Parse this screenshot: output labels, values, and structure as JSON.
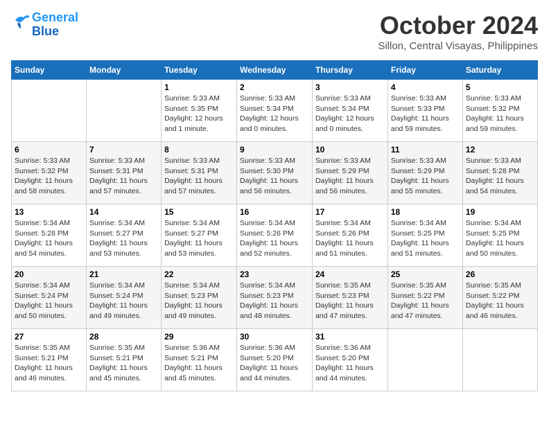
{
  "header": {
    "logo_line1": "General",
    "logo_line2": "Blue",
    "month": "October 2024",
    "location": "Sillon, Central Visayas, Philippines"
  },
  "days_of_week": [
    "Sunday",
    "Monday",
    "Tuesday",
    "Wednesday",
    "Thursday",
    "Friday",
    "Saturday"
  ],
  "weeks": [
    [
      {
        "num": "",
        "info": ""
      },
      {
        "num": "",
        "info": ""
      },
      {
        "num": "1",
        "info": "Sunrise: 5:33 AM\nSunset: 5:35 PM\nDaylight: 12 hours\nand 1 minute."
      },
      {
        "num": "2",
        "info": "Sunrise: 5:33 AM\nSunset: 5:34 PM\nDaylight: 12 hours\nand 0 minutes."
      },
      {
        "num": "3",
        "info": "Sunrise: 5:33 AM\nSunset: 5:34 PM\nDaylight: 12 hours\nand 0 minutes."
      },
      {
        "num": "4",
        "info": "Sunrise: 5:33 AM\nSunset: 5:33 PM\nDaylight: 11 hours\nand 59 minutes."
      },
      {
        "num": "5",
        "info": "Sunrise: 5:33 AM\nSunset: 5:32 PM\nDaylight: 11 hours\nand 59 minutes."
      }
    ],
    [
      {
        "num": "6",
        "info": "Sunrise: 5:33 AM\nSunset: 5:32 PM\nDaylight: 11 hours\nand 58 minutes."
      },
      {
        "num": "7",
        "info": "Sunrise: 5:33 AM\nSunset: 5:31 PM\nDaylight: 11 hours\nand 57 minutes."
      },
      {
        "num": "8",
        "info": "Sunrise: 5:33 AM\nSunset: 5:31 PM\nDaylight: 11 hours\nand 57 minutes."
      },
      {
        "num": "9",
        "info": "Sunrise: 5:33 AM\nSunset: 5:30 PM\nDaylight: 11 hours\nand 56 minutes."
      },
      {
        "num": "10",
        "info": "Sunrise: 5:33 AM\nSunset: 5:29 PM\nDaylight: 11 hours\nand 56 minutes."
      },
      {
        "num": "11",
        "info": "Sunrise: 5:33 AM\nSunset: 5:29 PM\nDaylight: 11 hours\nand 55 minutes."
      },
      {
        "num": "12",
        "info": "Sunrise: 5:33 AM\nSunset: 5:28 PM\nDaylight: 11 hours\nand 54 minutes."
      }
    ],
    [
      {
        "num": "13",
        "info": "Sunrise: 5:34 AM\nSunset: 5:28 PM\nDaylight: 11 hours\nand 54 minutes."
      },
      {
        "num": "14",
        "info": "Sunrise: 5:34 AM\nSunset: 5:27 PM\nDaylight: 11 hours\nand 53 minutes."
      },
      {
        "num": "15",
        "info": "Sunrise: 5:34 AM\nSunset: 5:27 PM\nDaylight: 11 hours\nand 53 minutes."
      },
      {
        "num": "16",
        "info": "Sunrise: 5:34 AM\nSunset: 5:26 PM\nDaylight: 11 hours\nand 52 minutes."
      },
      {
        "num": "17",
        "info": "Sunrise: 5:34 AM\nSunset: 5:26 PM\nDaylight: 11 hours\nand 51 minutes."
      },
      {
        "num": "18",
        "info": "Sunrise: 5:34 AM\nSunset: 5:25 PM\nDaylight: 11 hours\nand 51 minutes."
      },
      {
        "num": "19",
        "info": "Sunrise: 5:34 AM\nSunset: 5:25 PM\nDaylight: 11 hours\nand 50 minutes."
      }
    ],
    [
      {
        "num": "20",
        "info": "Sunrise: 5:34 AM\nSunset: 5:24 PM\nDaylight: 11 hours\nand 50 minutes."
      },
      {
        "num": "21",
        "info": "Sunrise: 5:34 AM\nSunset: 5:24 PM\nDaylight: 11 hours\nand 49 minutes."
      },
      {
        "num": "22",
        "info": "Sunrise: 5:34 AM\nSunset: 5:23 PM\nDaylight: 11 hours\nand 49 minutes."
      },
      {
        "num": "23",
        "info": "Sunrise: 5:34 AM\nSunset: 5:23 PM\nDaylight: 11 hours\nand 48 minutes."
      },
      {
        "num": "24",
        "info": "Sunrise: 5:35 AM\nSunset: 5:23 PM\nDaylight: 11 hours\nand 47 minutes."
      },
      {
        "num": "25",
        "info": "Sunrise: 5:35 AM\nSunset: 5:22 PM\nDaylight: 11 hours\nand 47 minutes."
      },
      {
        "num": "26",
        "info": "Sunrise: 5:35 AM\nSunset: 5:22 PM\nDaylight: 11 hours\nand 46 minutes."
      }
    ],
    [
      {
        "num": "27",
        "info": "Sunrise: 5:35 AM\nSunset: 5:21 PM\nDaylight: 11 hours\nand 46 minutes."
      },
      {
        "num": "28",
        "info": "Sunrise: 5:35 AM\nSunset: 5:21 PM\nDaylight: 11 hours\nand 45 minutes."
      },
      {
        "num": "29",
        "info": "Sunrise: 5:36 AM\nSunset: 5:21 PM\nDaylight: 11 hours\nand 45 minutes."
      },
      {
        "num": "30",
        "info": "Sunrise: 5:36 AM\nSunset: 5:20 PM\nDaylight: 11 hours\nand 44 minutes."
      },
      {
        "num": "31",
        "info": "Sunrise: 5:36 AM\nSunset: 5:20 PM\nDaylight: 11 hours\nand 44 minutes."
      },
      {
        "num": "",
        "info": ""
      },
      {
        "num": "",
        "info": ""
      }
    ]
  ]
}
